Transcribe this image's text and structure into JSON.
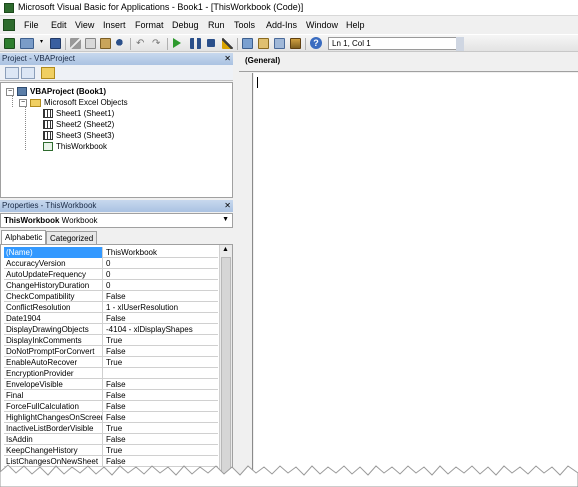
{
  "window": {
    "title": "Microsoft Visual Basic for Applications - Book1 - [ThisWorkbook (Code)]"
  },
  "menu": {
    "items": [
      {
        "label": "File"
      },
      {
        "label": "Edit"
      },
      {
        "label": "View"
      },
      {
        "label": "Insert"
      },
      {
        "label": "Format"
      },
      {
        "label": "Debug"
      },
      {
        "label": "Run"
      },
      {
        "label": "Tools"
      },
      {
        "label": "Add-Ins"
      },
      {
        "label": "Window"
      },
      {
        "label": "Help"
      }
    ]
  },
  "toolbar": {
    "position": "Ln 1, Col 1",
    "icons": [
      "excel-icon",
      "insert-icon",
      "save-icon",
      "cut-icon",
      "copy-icon",
      "paste-icon",
      "find-icon",
      "undo-icon",
      "redo-icon",
      "run-icon",
      "break-icon",
      "reset-icon",
      "design-mode-icon",
      "project-explorer-icon",
      "properties-icon",
      "object-browser-icon",
      "toolbox-icon",
      "help-icon"
    ]
  },
  "project": {
    "title": "Project - VBAProject",
    "root": "VBAProject (Book1)",
    "folder": "Microsoft Excel Objects",
    "items": [
      {
        "label": "Sheet1 (Sheet1)"
      },
      {
        "label": "Sheet2 (Sheet2)"
      },
      {
        "label": "Sheet3 (Sheet3)"
      },
      {
        "label": "ThisWorkbook"
      }
    ]
  },
  "properties": {
    "title": "Properties - ThisWorkbook",
    "object_name": "ThisWorkbook",
    "object_type": "Workbook",
    "tabs": [
      "Alphabetic",
      "Categorized"
    ],
    "rows": [
      {
        "name": "(Name)",
        "value": "ThisWorkbook"
      },
      {
        "name": "AccuracyVersion",
        "value": "0"
      },
      {
        "name": "AutoUpdateFrequency",
        "value": "0"
      },
      {
        "name": "ChangeHistoryDuration",
        "value": "0"
      },
      {
        "name": "CheckCompatibility",
        "value": "False"
      },
      {
        "name": "ConflictResolution",
        "value": "1 - xlUserResolution"
      },
      {
        "name": "Date1904",
        "value": "False"
      },
      {
        "name": "DisplayDrawingObjects",
        "value": "-4104 - xlDisplayShapes"
      },
      {
        "name": "DisplayInkComments",
        "value": "True"
      },
      {
        "name": "DoNotPromptForConvert",
        "value": "False"
      },
      {
        "name": "EnableAutoRecover",
        "value": "True"
      },
      {
        "name": "EncryptionProvider",
        "value": ""
      },
      {
        "name": "EnvelopeVisible",
        "value": "False"
      },
      {
        "name": "Final",
        "value": "False"
      },
      {
        "name": "ForceFullCalculation",
        "value": "False"
      },
      {
        "name": "HighlightChangesOnScreen",
        "value": "False"
      },
      {
        "name": "InactiveListBorderVisible",
        "value": "True"
      },
      {
        "name": "IsAddin",
        "value": "False"
      },
      {
        "name": "KeepChangeHistory",
        "value": "True"
      },
      {
        "name": "ListChangesOnNewSheet",
        "value": "False"
      }
    ]
  },
  "code": {
    "object_combo": "(General)"
  }
}
